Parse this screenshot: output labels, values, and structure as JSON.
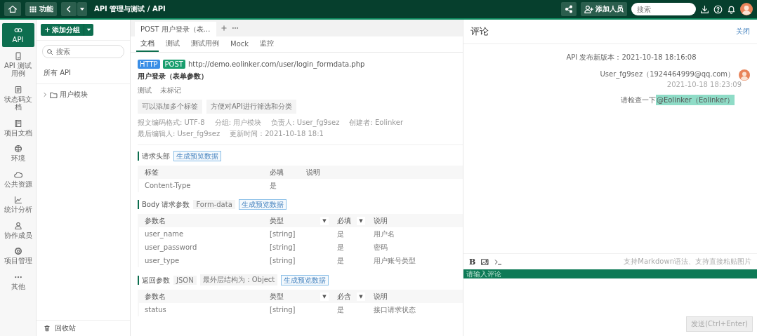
{
  "top_bar": {
    "function_button": "功能",
    "breadcrumb": "API 管理与测试 / API",
    "add_member_button": "添加人员",
    "search": {
      "placeholder": "搜索"
    }
  },
  "nav": {
    "items": [
      {
        "label": "API",
        "selected": true
      },
      {
        "label": "API 测试用例",
        "selected": false
      },
      {
        "label": "状态码文档",
        "selected": false
      },
      {
        "label": "项目文档",
        "selected": false
      },
      {
        "label": "环境",
        "selected": false
      },
      {
        "label": "公共资源",
        "selected": false
      },
      {
        "label": "统计分析",
        "selected": false
      },
      {
        "label": "协作成员",
        "selected": false
      },
      {
        "label": "项目管理",
        "selected": false
      },
      {
        "label": "其他",
        "selected": false
      }
    ]
  },
  "tree": {
    "add_group_button": "添加分组",
    "search": {
      "placeholder": "搜索"
    },
    "all_apis": "所有 API",
    "groups": [
      {
        "label": "用户模块",
        "expanded": false
      }
    ],
    "recycle_bin": "回收站"
  },
  "main": {
    "tabs": [
      {
        "label": "POST 用户登录（表…",
        "selected": true
      }
    ],
    "sub_tabs": [
      {
        "label": "文档",
        "selected": true
      },
      {
        "label": "测试",
        "selected": false
      },
      {
        "label": "测试用例",
        "selected": false
      },
      {
        "label": "Mock",
        "selected": false
      },
      {
        "label": "监控",
        "selected": false
      }
    ],
    "api": {
      "badges": [
        {
          "text": "HTTP",
          "color": "#3a8ee6"
        },
        {
          "text": "POST",
          "color": "#1a9e6e"
        }
      ],
      "url": "http://demo.eolinker.com/user/login_formdata.php",
      "name": "用户登录（表单参数）",
      "mark_label": "测试",
      "mark_value": "未标记",
      "tags": [
        "可以添加多个标签",
        "方便对API进行筛选和分类"
      ],
      "meta": [
        "报文编码格式: UTF-8",
        "分组: 用户模块",
        "负责人: User_fg9sez",
        "创建者: Eolinker",
        "最后编辑人: User_fg9sez",
        "更新时间：2021-10-18 18:1"
      ]
    },
    "sections": [
      {
        "title": "请求头部",
        "preview_button": "生成预览数据",
        "table": {
          "columns": [
            {
              "label": "标签",
              "kind": "name"
            },
            {
              "label": "必填",
              "kind": "required"
            },
            {
              "label": "说明",
              "kind": "desc"
            }
          ],
          "rows": [
            {
              "cells": [
                "Content-Type",
                "是"
              ]
            }
          ]
        }
      },
      {
        "title": "Body 请求参数",
        "chips": [
          "Form-data"
        ],
        "preview_button": "生成预览数据",
        "table": {
          "columns": [
            {
              "label": "参数名",
              "kind": "name"
            },
            {
              "label": "类型",
              "kind": "type",
              "filter": "▼"
            },
            {
              "label": "必填",
              "kind": "required",
              "filter": "▼"
            },
            {
              "label": "说明",
              "kind": "desc"
            }
          ],
          "rows": [
            {
              "cells": [
                "user_name",
                "[string]",
                "是",
                "用户名"
              ]
            },
            {
              "cells": [
                "user_password",
                "[string]",
                "是",
                "密码"
              ]
            },
            {
              "cells": [
                "user_type",
                "[string]",
                "是",
                "用户账号类型"
              ]
            }
          ]
        }
      },
      {
        "title": "返回参数",
        "chips": [
          "JSON",
          "最外层结构为：Object"
        ],
        "preview_button": "生成预览数据",
        "table": {
          "columns": [
            {
              "label": "参数名",
              "kind": "name"
            },
            {
              "label": "类型",
              "kind": "type",
              "filter": "▼"
            },
            {
              "label": "必含",
              "kind": "required",
              "filter": "▼"
            },
            {
              "label": "说明",
              "kind": "desc"
            }
          ],
          "rows": [
            {
              "cells": [
                "status",
                "[string]",
                "是",
                "接口请求状态"
              ]
            }
          ]
        }
      }
    ]
  },
  "comments": {
    "title": "评论",
    "close": "关闭",
    "events": [
      {
        "kind": "system",
        "text": "API 发布新版本：2021-10-18 18:16:08"
      },
      {
        "kind": "comment",
        "author": "User_fg9sez（1924464999@qq.com）",
        "time": "2021-10-18 18:23:09",
        "text": "请检查一下",
        "mention": "@Eolinker（Eolinker）"
      }
    ],
    "editor": {
      "bold": "B",
      "hint": "支持Markdown语法、支持直接粘贴图片",
      "placeholder": "请输入评论",
      "send_button": "发送(Ctrl+Enter)",
      "send_disabled": true
    }
  }
}
